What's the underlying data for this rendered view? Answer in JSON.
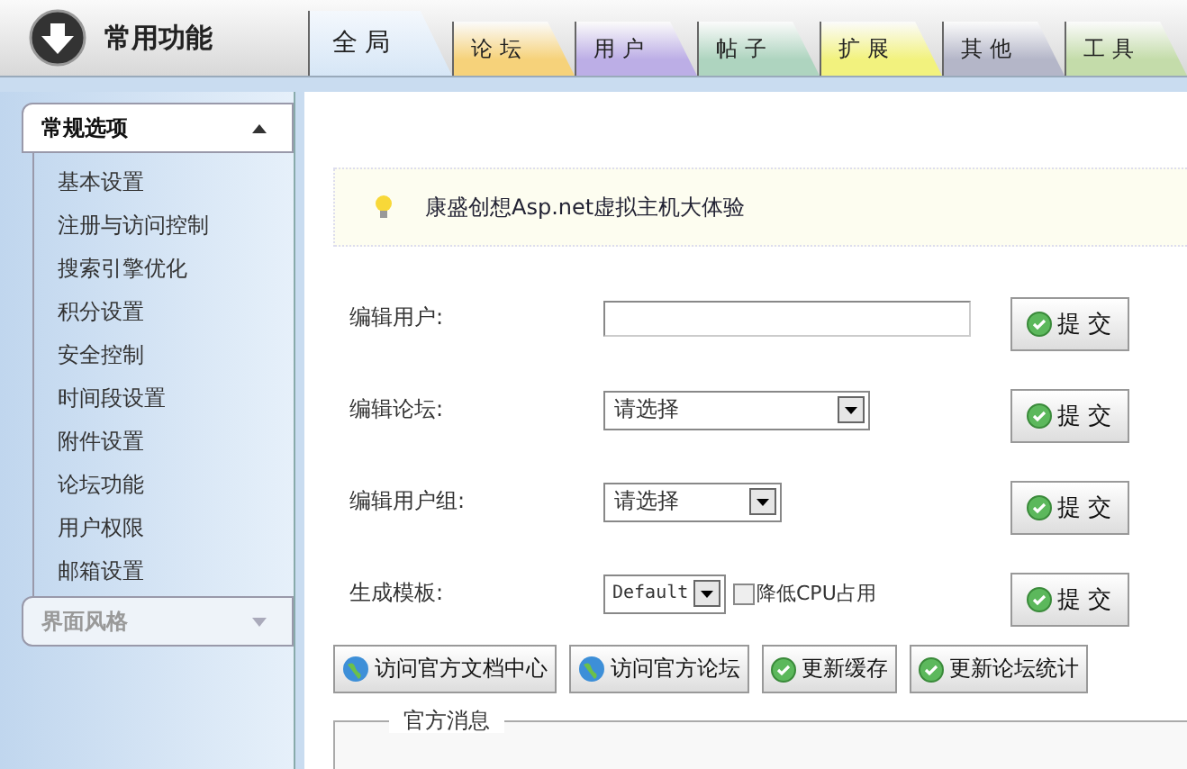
{
  "header": {
    "title": "常用功能"
  },
  "tabs": [
    {
      "label": "全局",
      "selected": true,
      "color": "#d6e6f6"
    },
    {
      "label": "论坛",
      "selected": false,
      "color": "#f6d27a"
    },
    {
      "label": "用户",
      "selected": false,
      "color": "#bcaee6"
    },
    {
      "label": "帖子",
      "selected": false,
      "color": "#aed4bf"
    },
    {
      "label": "扩展",
      "selected": false,
      "color": "#f2f27e"
    },
    {
      "label": "其他",
      "selected": false,
      "color": "#b4b6c8"
    },
    {
      "label": "工具",
      "selected": false,
      "color": "#c4dcaa"
    }
  ],
  "sidebar": {
    "sections": [
      {
        "title": "常规选项",
        "expanded": true,
        "items": [
          "基本设置",
          "注册与访问控制",
          "搜索引擎优化",
          "积分设置",
          "安全控制",
          "时间段设置",
          "附件设置",
          "论坛功能",
          "用户权限",
          "邮箱设置"
        ]
      },
      {
        "title": "界面风格",
        "expanded": false
      }
    ]
  },
  "notice": {
    "text": "康盛创想Asp.net虚拟主机大体验"
  },
  "form": [
    {
      "kind": "input",
      "label": "编辑用户:",
      "button": "提 交"
    },
    {
      "kind": "select",
      "label": "编辑论坛:",
      "value": "请选择",
      "button": "提 交"
    },
    {
      "kind": "select-short",
      "label": "编辑用户组:",
      "value": "请选择",
      "button": "提 交"
    },
    {
      "kind": "template",
      "label": "生成模板:",
      "value": "Default",
      "checkbox": {
        "label": "降低CPU占用",
        "checked": false
      },
      "button": "提 交"
    }
  ],
  "actions": [
    {
      "kind": "globe",
      "label": "访问官方文档中心"
    },
    {
      "kind": "globe",
      "label": "访问官方论坛"
    },
    {
      "kind": "check",
      "label": "更新缓存"
    },
    {
      "kind": "check",
      "label": "更新论坛统计"
    }
  ],
  "news": {
    "title": "官方消息"
  }
}
